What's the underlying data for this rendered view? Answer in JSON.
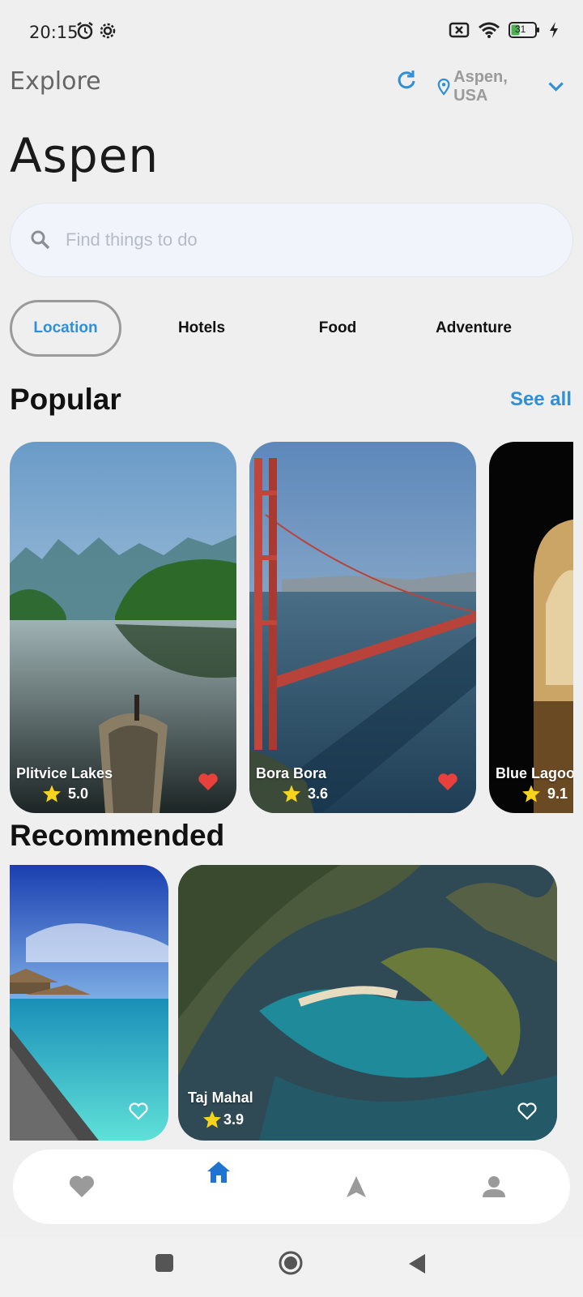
{
  "status": {
    "time": "20:15",
    "battery": "31"
  },
  "header": {
    "title": "Explore",
    "location": "Aspen, USA"
  },
  "hero_title": "Aspen",
  "search": {
    "placeholder": "Find things to do",
    "value": ""
  },
  "tabs": [
    {
      "label": "Location",
      "active": true
    },
    {
      "label": "Hotels",
      "active": false
    },
    {
      "label": "Food",
      "active": false
    },
    {
      "label": "Adventure",
      "active": false
    }
  ],
  "popular": {
    "title": "Popular",
    "see_all": "See all",
    "items": [
      {
        "name": "Plitvice Lakes",
        "rating": "5.0",
        "favorite": true
      },
      {
        "name": "Bora Bora",
        "rating": "3.6",
        "favorite": true
      },
      {
        "name": "Blue Lagoon",
        "rating": "9.1",
        "favorite": false
      }
    ]
  },
  "recommended": {
    "title": "Recommended",
    "items": [
      {
        "name": "",
        "rating": "",
        "favorite": false
      },
      {
        "name": "Taj Mahal",
        "rating": "3.9",
        "favorite": false
      }
    ]
  },
  "bottom_nav": [
    {
      "icon": "heart-icon",
      "active": false
    },
    {
      "icon": "home-icon",
      "active": true
    },
    {
      "icon": "navigation-icon",
      "active": false
    },
    {
      "icon": "person-icon",
      "active": false
    }
  ],
  "colors": {
    "accent": "#2f8fd8",
    "heart_red": "#e8403a",
    "star": "#f6d31c"
  }
}
